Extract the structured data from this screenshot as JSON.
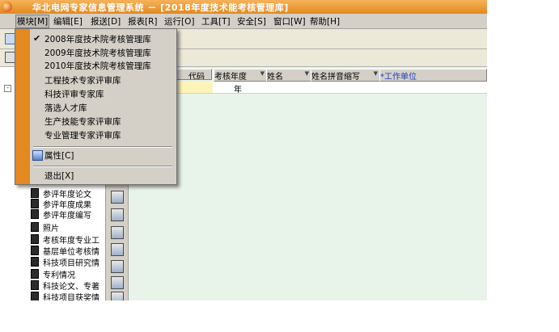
{
  "window": {
    "title": "华北电网专家信息管理系统 － [2018年度技术能考核管理库]"
  },
  "menubar": [
    {
      "label": "模块[M]",
      "active": true
    },
    {
      "label": "编辑[E]"
    },
    {
      "label": "报送[D]"
    },
    {
      "label": "报表[R]"
    },
    {
      "label": "运行[O]"
    },
    {
      "label": "工具[T]"
    },
    {
      "label": "安全[S]"
    },
    {
      "label": "窗口[W]"
    },
    {
      "label": "帮助[H]"
    }
  ],
  "module_menu": {
    "items": [
      {
        "label": "2008年度技术院考核管理库",
        "checked": true
      },
      {
        "label": "2009年度技术院考核管理库"
      },
      {
        "label": "2010年度技术院考核管理库"
      },
      {
        "label": "工程技术专家评审库"
      },
      {
        "label": "科技评审专家库"
      },
      {
        "label": "落选人才库"
      },
      {
        "label": "生产技能专家评审库"
      },
      {
        "label": "专业管理专家评审库"
      }
    ],
    "properties_label": "属性[C]",
    "exit_label": "退出[X]"
  },
  "tree": {
    "expander": "-",
    "items": [
      "参评年度论文",
      "参评年度成果",
      "参评年度编写",
      "照片",
      "考核年度专业工",
      "基层单位考核情",
      "科技项目研究情",
      "专利情况",
      "科技论文、专著",
      "科技项目获奖情"
    ]
  },
  "grid": {
    "columns": [
      "代码",
      "考核年度",
      "姓名",
      "姓名拼音缩写",
      "*工作单位"
    ],
    "rows": [
      [
        "",
        "年",
        "",
        "",
        ""
      ]
    ]
  },
  "icons": {
    "app": "app-logo-icon",
    "menu_check": "checkmark-icon",
    "properties": "properties-icon"
  }
}
